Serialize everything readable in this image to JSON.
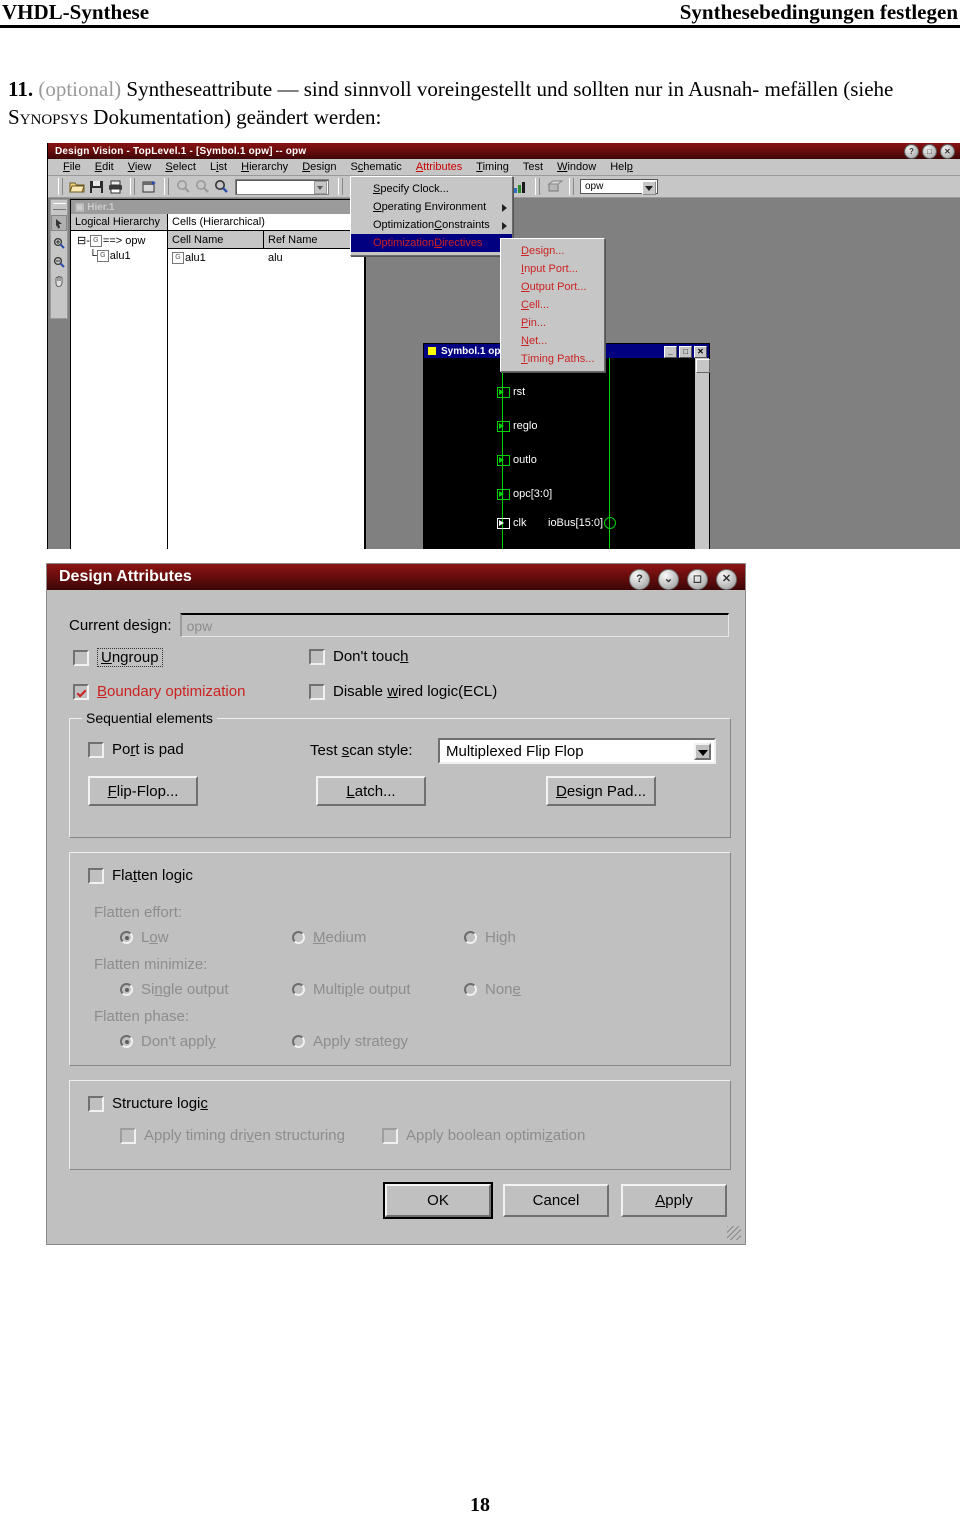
{
  "document": {
    "header_left": "VHDL-Synthese",
    "header_right": "Synthesebedingungen festlegen",
    "item_number": "11.",
    "item_optional": "(optional)",
    "item_text_1": "Syntheseattribute — sind sinnvoll voreingestellt und sollten nur in Ausnah-",
    "item_text_2a": "mefällen (siehe ",
    "item_smallcaps": "Synopsys",
    "item_text_2b": " Dokumentation) geändert werden:",
    "page_number": "18"
  },
  "design_vision": {
    "title": "Design Vision - TopLevel.1 - [Symbol.1   opw] -- opw",
    "window_buttons": [
      "?",
      "□",
      "✕"
    ],
    "menu": [
      {
        "label": "File",
        "accel": "F"
      },
      {
        "label": "Edit",
        "accel": "E"
      },
      {
        "label": "View",
        "accel": "V"
      },
      {
        "label": "Select",
        "accel": "S"
      },
      {
        "label": "List",
        "accel": "i"
      },
      {
        "label": "Hierarchy",
        "accel": "H"
      },
      {
        "label": "Design",
        "accel": "D"
      },
      {
        "label": "Schematic",
        "accel": "c"
      },
      {
        "label": "Attributes",
        "accel": "A"
      },
      {
        "label": "Timing",
        "accel": "T"
      },
      {
        "label": "Test",
        "accel": ""
      },
      {
        "label": "Window",
        "accel": "W"
      },
      {
        "label": "Help",
        "accel": "p"
      }
    ],
    "toolbar": {
      "icons": [
        "open-folder-icon",
        "save-disk-icon",
        "print-icon",
        "new-window-icon",
        "zoom-in-icon",
        "zoom-out-icon",
        "zoom-fit-icon",
        "zoom-area-icon",
        "zoom-prev-icon",
        "zoom-next-icon",
        "check-design-icon",
        "check-timing-icon",
        "report-icon",
        "compile-icon",
        "optimize-icon",
        "analyze-icon",
        "clock-icon"
      ],
      "search_value": "",
      "design_combo_value": "opw"
    },
    "side_tools": [
      "pointer-icon",
      "zoom-in-icon",
      "zoom-out-icon",
      "pan-hand-icon"
    ],
    "hierarchy_window": {
      "title": "Hier.1",
      "left_column_header": "Logical Hierarchy",
      "tree": [
        {
          "label": "==> opw",
          "indent": 0
        },
        {
          "label": "alu1",
          "indent": 1
        }
      ],
      "right_panel_title": "Cells (Hierarchical)",
      "table_headers": [
        "Cell Name",
        "Ref Name"
      ],
      "table_rows": [
        [
          "alu1",
          "alu"
        ]
      ],
      "overflow_cell": "alu1"
    },
    "attributes_menu": [
      {
        "label": "Specify Clock...",
        "accel": "S",
        "submenu": false,
        "selected": false
      },
      {
        "label": "Operating Environment",
        "accel": "O",
        "submenu": true,
        "selected": false
      },
      {
        "label": "Optimization Constraints",
        "accel": "C",
        "submenu": true,
        "selected": false
      },
      {
        "label": "Optimization Directives",
        "accel": "D",
        "submenu": true,
        "selected": true
      }
    ],
    "directives_submenu": [
      {
        "label": "Design...",
        "accel": "D"
      },
      {
        "label": "Input Port...",
        "accel": "I"
      },
      {
        "label": "Output Port...",
        "accel": "O"
      },
      {
        "label": "Cell...",
        "accel": "C"
      },
      {
        "label": "Pin...",
        "accel": "P"
      },
      {
        "label": "Net...",
        "accel": "N"
      },
      {
        "label": "Timing Paths...",
        "accel": "T"
      }
    ],
    "symbol_window": {
      "title": "Symbol.1    opw",
      "buttons": [
        "_",
        "□",
        "✕"
      ],
      "ports": [
        "rst",
        "reglo",
        "outlo",
        "opc[3:0]",
        "clk"
      ],
      "right_port": "ioBus[15:0]"
    }
  },
  "design_attributes": {
    "title": "Design Attributes",
    "title_buttons": [
      "?",
      "⌄",
      "◻",
      "✕"
    ],
    "current_design_label": "Current design:",
    "current_design_value": "opw",
    "checkboxes": [
      {
        "label": "Ungroup",
        "accel": "U",
        "checked": false,
        "focused": true
      },
      {
        "label": "Don't touch",
        "accel": "h",
        "checked": false,
        "focused": false
      },
      {
        "label": "Boundary optimization",
        "accel": "B",
        "checked": true,
        "focused": false
      },
      {
        "label": "Disable wired logic(ECL)",
        "accel": "w",
        "checked": false,
        "focused": false
      }
    ],
    "sequential": {
      "legend": "Sequential elements",
      "port_is_pad": {
        "label": "Port is pad",
        "accel": "r",
        "checked": false
      },
      "test_scan_label": "Test scan style:",
      "test_scan_accel": "s",
      "test_scan_value": "Multiplexed Flip Flop",
      "buttons": [
        {
          "label": "Flip-Flop...",
          "accel": "F"
        },
        {
          "label": "Latch...",
          "accel": "L"
        },
        {
          "label": "Design Pad...",
          "accel": "D"
        }
      ]
    },
    "flatten": {
      "checkbox": {
        "label": "Flatten logic",
        "accel": "t",
        "checked": false
      },
      "effort_label": "Flatten effort:",
      "effort_options": [
        {
          "label": "Low",
          "accel": "o",
          "selected": true
        },
        {
          "label": "Medium",
          "accel": "M",
          "selected": false
        },
        {
          "label": "High",
          "accel": "g",
          "selected": false
        }
      ],
      "minimize_label": "Flatten minimize:",
      "minimize_options": [
        {
          "label": "Single output",
          "accel": "n",
          "selected": true
        },
        {
          "label": "Multiple output",
          "accel": "p",
          "selected": false
        },
        {
          "label": "None",
          "accel": "e",
          "selected": false
        }
      ],
      "phase_label": "Flatten phase:",
      "phase_options": [
        {
          "label": "Don't apply",
          "accel": "y",
          "selected": true
        },
        {
          "label": "Apply strategy",
          "accel": "",
          "selected": false
        }
      ]
    },
    "structure": {
      "checkbox": {
        "label": "Structure logic",
        "accel": "c",
        "checked": false
      },
      "sub": [
        {
          "label": "Apply timing driven structuring",
          "accel": "v",
          "checked": false
        },
        {
          "label": "Apply boolean optimization",
          "accel": "z",
          "checked": false
        }
      ]
    },
    "actions": [
      {
        "label": "OK",
        "accel": "",
        "default": true
      },
      {
        "label": "Cancel",
        "accel": "",
        "default": false
      },
      {
        "label": "Apply",
        "accel": "A",
        "default": false
      }
    ]
  }
}
